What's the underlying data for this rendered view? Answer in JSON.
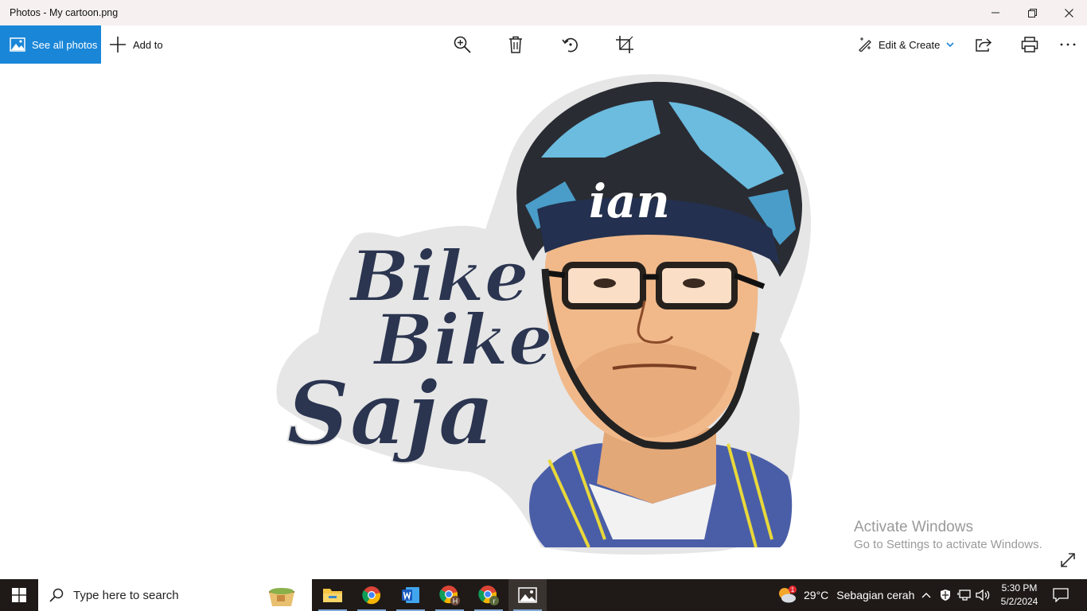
{
  "window": {
    "title": "Photos - My cartoon.png"
  },
  "toolbar": {
    "see_all_label": "See all photos",
    "add_to_label": "Add to",
    "edit_create_label": "Edit & Create",
    "accent": "#1a86d8"
  },
  "artwork": {
    "headband_text": "ian",
    "lettering_line1": "Bike",
    "lettering_line2": "Bike",
    "lettering_line3": "Saja"
  },
  "watermark": {
    "title": "Activate Windows",
    "subtitle": "Go to Settings to activate Windows."
  },
  "taskbar": {
    "search_placeholder": "Type here to search",
    "weather_temp": "29°C",
    "weather_condition": "Sebagian cerah",
    "weather_badge": "1",
    "clock_time": "5:30 PM",
    "clock_date": "5/2/2024",
    "chrome_profile_1": "H",
    "chrome_profile_2": "r"
  }
}
